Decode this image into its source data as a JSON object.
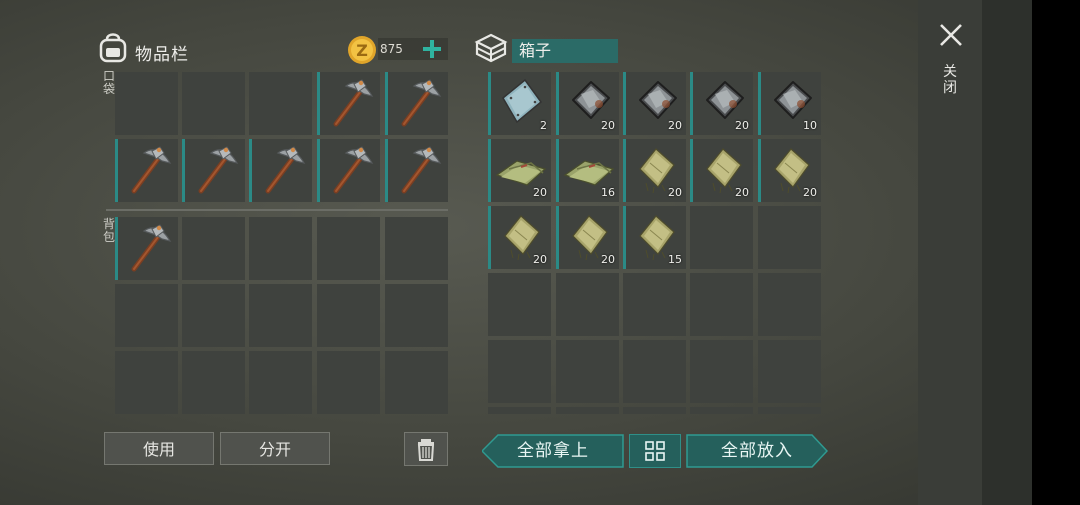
{
  "inventory": {
    "title": "物品栏",
    "pocket_label": "口袋",
    "backpack_label": "背包",
    "coins": "875",
    "add_coins_icon": "plus-icon",
    "pocket_slots": [
      "",
      "",
      "",
      "pickaxe",
      "pickaxe",
      "pickaxe",
      "pickaxe",
      "pickaxe",
      "pickaxe",
      "pickaxe"
    ],
    "backpack_slots": [
      "pickaxe",
      "",
      "",
      "",
      "",
      "",
      "",
      "",
      "",
      "",
      "",
      "",
      "",
      "",
      ""
    ]
  },
  "container": {
    "name": "箱子",
    "items": [
      {
        "icon": "metal-plate",
        "qty": "2"
      },
      {
        "icon": "scrap-metal",
        "qty": "20"
      },
      {
        "icon": "scrap-metal",
        "qty": "20"
      },
      {
        "icon": "scrap-metal",
        "qty": "20"
      },
      {
        "icon": "scrap-metal",
        "qty": "10"
      },
      {
        "icon": "folded-cloth",
        "qty": "20"
      },
      {
        "icon": "folded-cloth",
        "qty": "16"
      },
      {
        "icon": "cloth-scrap",
        "qty": "20"
      },
      {
        "icon": "cloth-scrap",
        "qty": "20"
      },
      {
        "icon": "cloth-scrap",
        "qty": "20"
      },
      {
        "icon": "cloth-scrap",
        "qty": "20"
      },
      {
        "icon": "cloth-scrap",
        "qty": "20"
      },
      {
        "icon": "cloth-scrap",
        "qty": "15"
      },
      {
        "icon": "",
        "qty": ""
      },
      {
        "icon": "",
        "qty": ""
      }
    ]
  },
  "buttons": {
    "use": "使用",
    "split": "分开",
    "take_all": "全部拿上",
    "put_all": "全部放入",
    "close": "关闭"
  },
  "colors": {
    "accent": "#2b8a86",
    "plus": "#2fb3a0",
    "slot": "#3f423e"
  }
}
